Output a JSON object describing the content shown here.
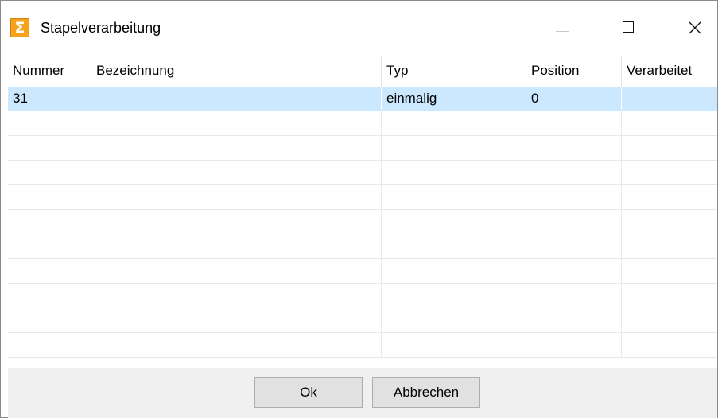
{
  "window": {
    "title": "Stapelverarbeitung",
    "icon": "sigma-icon"
  },
  "grid": {
    "columns": [
      "Nummer",
      "Bezeichnung",
      "Typ",
      "Position",
      "Verarbeitet"
    ],
    "rows": [
      {
        "nummer": "31",
        "bezeichnung": "",
        "typ": "einmalig",
        "position": "0",
        "verarbeitet": "",
        "selected": true
      }
    ],
    "empty_rows": 10,
    "selection_color": "#cce8ff"
  },
  "buttons": {
    "ok_label": "Ok",
    "cancel_label": "Abbrechen"
  },
  "colors": {
    "icon_accent": "#f6a21b",
    "footer_bg": "#f0f0f0",
    "button_bg": "#e1e1e1"
  }
}
